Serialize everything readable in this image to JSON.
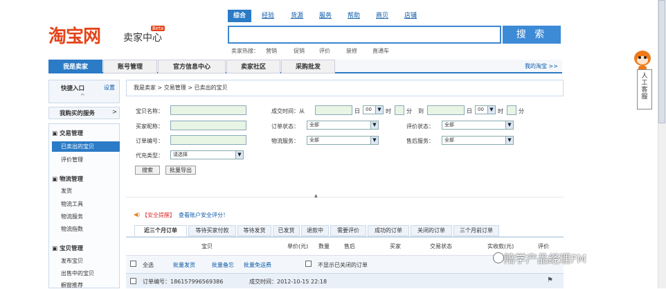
{
  "header": {
    "logo": "淘宝网",
    "logo_sub": "卖家中心",
    "beta": "Beta"
  },
  "search_tabs": [
    "综合",
    "经验",
    "货源",
    "服务",
    "帮助",
    "商贝",
    "店铺"
  ],
  "search": {
    "value": "",
    "button": "搜 索"
  },
  "hot": {
    "prefix": "卖家热搜：",
    "items": [
      "营销",
      "促销",
      "评价",
      "装修",
      "直通车"
    ]
  },
  "nav": [
    "我是卖家",
    "账号管理",
    "官方信息中心",
    "卖家社区",
    "采购批发"
  ],
  "nav_right": "我的淘宝 >>",
  "side": {
    "quick": "快捷入口",
    "settings": "设置",
    "buy_service": "我购买的服务",
    "buy_arrow": ">",
    "trade_head": "交易管理",
    "trade_items": [
      "已卖出的宝贝",
      "评价管理"
    ],
    "logistics_head": "物流管理",
    "logistics_items": [
      "发货",
      "物流工具",
      "物流服务",
      "物流指数"
    ],
    "goods_head": "宝贝管理",
    "goods_items": [
      "发布宝贝",
      "出售中的宝贝",
      "橱窗推荐"
    ]
  },
  "breadcrumb": "我是卖家 > 交易管理 > 已卖出的宝贝",
  "form": {
    "item_name": "宝贝名称：",
    "time_label": "成交时间：从",
    "to": "到",
    "day": "日",
    "hour": "时",
    "minute": "分",
    "hour_val": "00",
    "buyer": "买家昵称：",
    "order_status": "订单状态：",
    "order_status_val": "全部",
    "eval_status": "评价状态：",
    "eval_status_val": "全部",
    "order_no": "订单编号：",
    "logistics": "物流服务：",
    "logistics_val": "全部",
    "after_sale": "售后服务：",
    "after_sale_val": "全部",
    "type": "代充类型：",
    "type_val": "请选择",
    "search_btn": "搜索",
    "export_btn": "批量导出"
  },
  "notice": {
    "tag": "【安全提醒】",
    "text": "查看账户安全评分！"
  },
  "order_tabs": [
    "近三个月订单",
    "等待买家付款",
    "等待发货",
    "已发货",
    "退款中",
    "需要评价",
    "成功的订单",
    "关闭的订单",
    "三个月前订单"
  ],
  "table_header": [
    "宝贝",
    "单价(元)",
    "数量",
    "售后",
    "买家",
    "交易状态",
    "实收款(元)",
    "评价"
  ],
  "bulk": {
    "select_all": "全选",
    "ship": "批量发货",
    "remark": "批量备忘",
    "free": "批量免运费",
    "hide_closed": "不显示已关闭的订单"
  },
  "order": {
    "no": "订单编号：186157996569386",
    "time": "成交时间：2012-10-15 22:18"
  },
  "service_widget": "人工客服",
  "watermark": "陪学产品经理FM",
  "colors": {
    "brand": "#e4441a",
    "accent": "#2b7bc6",
    "link": "#0a59a8"
  }
}
